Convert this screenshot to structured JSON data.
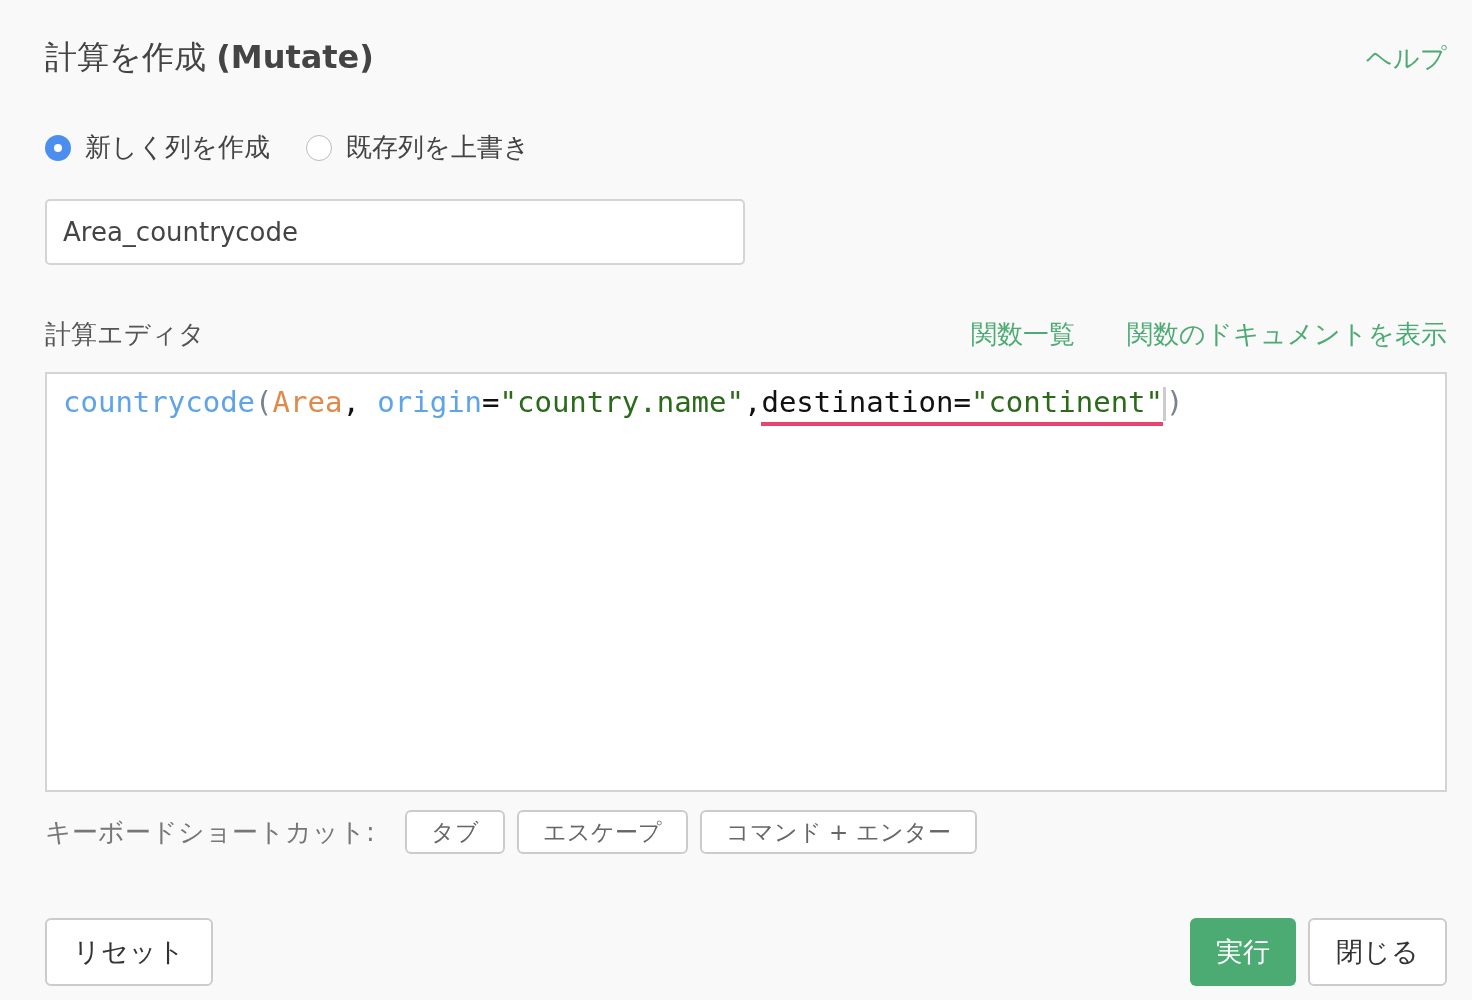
{
  "dialog": {
    "title": "計算を作成 (Mutate)",
    "help_link": "ヘルプ"
  },
  "mode_options": [
    {
      "label": "新しく列を作成",
      "selected": true
    },
    {
      "label": "既存列を上書き",
      "selected": false
    }
  ],
  "column_name": {
    "value": "Area_countrycode"
  },
  "editor": {
    "label": "計算エディタ",
    "links": [
      "関数一覧",
      "関数のドキュメントを表示"
    ],
    "tokens": [
      {
        "text": "countrycode",
        "kind": "function",
        "error": false
      },
      {
        "text": "(",
        "kind": "punct",
        "error": false
      },
      {
        "text": "Area",
        "kind": "column",
        "error": false
      },
      {
        "text": ", ",
        "kind": "plain",
        "error": false
      },
      {
        "text": "origin",
        "kind": "function",
        "error": false
      },
      {
        "text": "=",
        "kind": "plain",
        "error": false
      },
      {
        "text": "\"country.name\"",
        "kind": "string",
        "error": false
      },
      {
        "text": ",",
        "kind": "plain",
        "error": false
      },
      {
        "text": "destination=",
        "kind": "plain",
        "error": true
      },
      {
        "text": "\"continent\"",
        "kind": "string",
        "error": true
      },
      {
        "text": ")",
        "kind": "punct",
        "error": false
      }
    ]
  },
  "shortcuts": {
    "label": "キーボードショートカット:",
    "keys": [
      "タブ",
      "エスケープ",
      "コマンド + エンター"
    ]
  },
  "buttons": {
    "reset": "リセット",
    "run": "実行",
    "close": "閉じる"
  }
}
